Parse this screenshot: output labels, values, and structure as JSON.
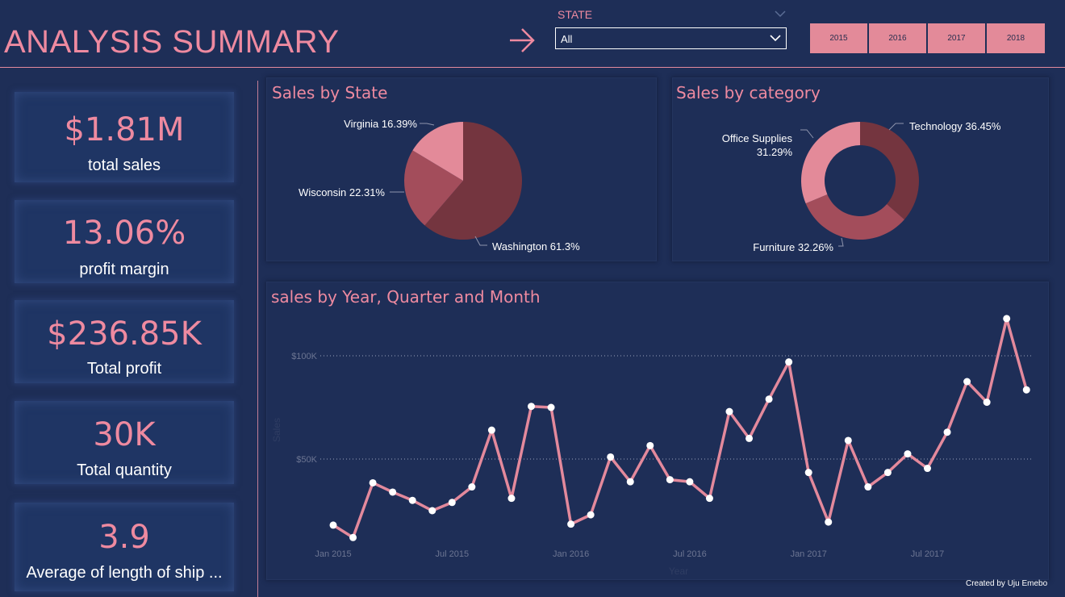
{
  "header": {
    "title": "ANALYSIS SUMMARY",
    "state_filter": {
      "label": "STATE",
      "value": "All"
    },
    "year_buttons": [
      "2015",
      "2016",
      "2017",
      "2018"
    ]
  },
  "kpis": [
    {
      "value": "$1.81M",
      "label": "total sales"
    },
    {
      "value": "13.06%",
      "label": "profit margin"
    },
    {
      "value": "$236.85K",
      "label": "Total profit"
    },
    {
      "value": "30K",
      "label": "Total quantity"
    },
    {
      "value": "3.9",
      "label": "Average of length of ship ..."
    }
  ],
  "colors": {
    "background": "#1e2e57",
    "accent": "#ee8aa0",
    "slice_dark": "#74353f",
    "slice_mid": "#a34d5b",
    "slice_light": "#e38a99"
  },
  "chart_data": [
    {
      "type": "pie",
      "title": "Sales by State",
      "categories": [
        "Washington",
        "Wisconsin",
        "Virginia"
      ],
      "values": [
        61.3,
        22.31,
        16.39
      ],
      "labels": [
        "Washington 61.3%",
        "Wisconsin 22.31%",
        "Virginia 16.39%"
      ]
    },
    {
      "type": "pie",
      "title": "Sales by category",
      "donut": true,
      "categories": [
        "Technology",
        "Furniture",
        "Office Supplies"
      ],
      "values": [
        36.45,
        32.26,
        31.29
      ],
      "labels": [
        "Technology 36.45%",
        "Furniture 32.26%",
        "Office Supplies",
        "31.29%"
      ]
    },
    {
      "type": "line",
      "title": "sales by Year, Quarter and Month",
      "xlabel": "Year",
      "ylabel": "Sales",
      "ylim": [
        0,
        120000
      ],
      "y_ticks": [
        50000,
        100000
      ],
      "y_tick_labels": [
        "$50K",
        "$100K"
      ],
      "x_tick_labels": [
        "Jan 2015",
        "Jul 2015",
        "Jan 2016",
        "Jul 2016",
        "Jan 2017",
        "Jul 2017"
      ],
      "grid": "horizontal-dotted",
      "x": [
        "2015-01",
        "2015-02",
        "2015-03",
        "2015-04",
        "2015-05",
        "2015-06",
        "2015-07",
        "2015-08",
        "2015-09",
        "2015-10",
        "2015-11",
        "2015-12",
        "2016-01",
        "2016-02",
        "2016-03",
        "2016-04",
        "2016-05",
        "2016-06",
        "2016-07",
        "2016-08",
        "2016-09",
        "2016-10",
        "2016-11",
        "2016-12",
        "2017-01",
        "2017-02",
        "2017-03",
        "2017-04",
        "2017-05",
        "2017-06",
        "2017-07",
        "2017-08",
        "2017-09",
        "2017-10",
        "2017-11",
        "2017-12"
      ],
      "series": [
        {
          "values": [
            18000,
            12000,
            38500,
            34000,
            30000,
            25000,
            29000,
            36500,
            64000,
            31000,
            75500,
            75000,
            18500,
            23000,
            51000,
            39000,
            56500,
            40000,
            39000,
            31000,
            73000,
            60000,
            79000,
            97000,
            43500,
            19500,
            59000,
            36500,
            43500,
            52500,
            45500,
            63000,
            87500,
            77500,
            118000,
            83500
          ]
        }
      ]
    }
  ],
  "footer": {
    "credit": "Created by Uju Emebo"
  }
}
